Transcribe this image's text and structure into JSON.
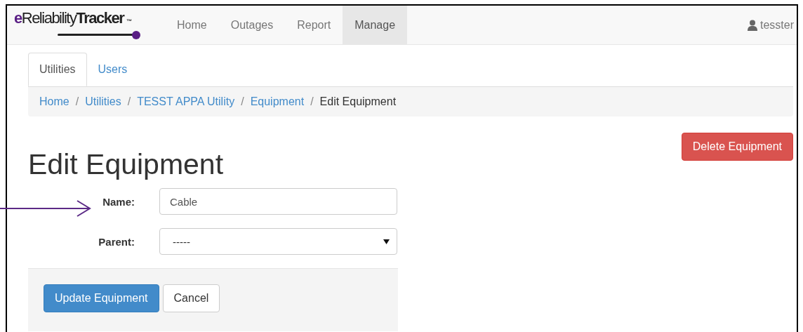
{
  "navbar": {
    "logo": {
      "prefix": "e",
      "middle": "Reliability",
      "bold": "Tracker",
      "mark": "™"
    },
    "items": [
      {
        "label": "Home",
        "selected": false
      },
      {
        "label": "Outages",
        "selected": false
      },
      {
        "label": "Report",
        "selected": false
      },
      {
        "label": "Manage",
        "selected": true
      }
    ],
    "user": "tesster"
  },
  "tabs": [
    {
      "label": "Utilities",
      "selected": true
    },
    {
      "label": "Users",
      "selected": false
    }
  ],
  "breadcrumb": [
    {
      "label": "Home",
      "current": false
    },
    {
      "label": "Utilities",
      "current": false
    },
    {
      "label": "TESST APPA Utility",
      "current": false
    },
    {
      "label": "Equipment",
      "current": false
    },
    {
      "label": "Edit Equipment",
      "current": true
    }
  ],
  "breadcrumb_separator": "/",
  "delete_button": "Delete Equipment",
  "heading": "Edit Equipment",
  "form": {
    "fields": [
      {
        "kind": "text",
        "label": "Name:",
        "value": "Cable"
      },
      {
        "kind": "select",
        "label": "Parent:",
        "value": "-----"
      }
    ]
  },
  "actions": {
    "primary": "Update Equipment",
    "secondary": "Cancel"
  }
}
